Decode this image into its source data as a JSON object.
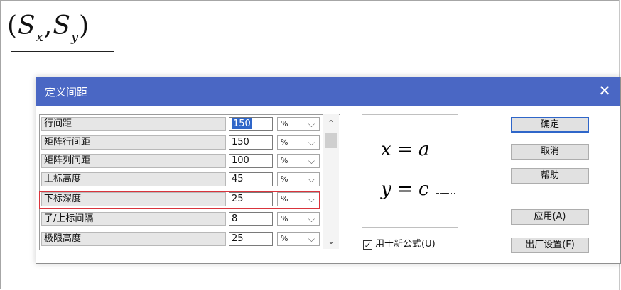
{
  "formula": {
    "open": "(",
    "s1": "S",
    "sub1": "x",
    "comma": ",",
    "s2": "S",
    "sub2": "y",
    "close": ")"
  },
  "dialog": {
    "title": "定义间距",
    "close_glyph": "✕",
    "rows": [
      {
        "name": "行间距",
        "value": "150",
        "unit": "%"
      },
      {
        "name": "矩阵行间距",
        "value": "150",
        "unit": "%"
      },
      {
        "name": "矩阵列间距",
        "value": "100",
        "unit": "%"
      },
      {
        "name": "上标高度",
        "value": "45",
        "unit": "%"
      },
      {
        "name": "下标深度",
        "value": "25",
        "unit": "%"
      },
      {
        "name": "子/上标间隔",
        "value": "8",
        "unit": "%"
      },
      {
        "name": "极限高度",
        "value": "25",
        "unit": "%"
      }
    ],
    "selected_row": "行间距",
    "highlighted_row": "下标深度",
    "dropdown_chevron": "⌵",
    "scroll_up": "⌃",
    "scroll_down": "⌄",
    "preview": {
      "line1": {
        "var": "x",
        "op": "=",
        "rhs": "a"
      },
      "line2": {
        "var": "y",
        "op": "=",
        "rhs": "c"
      }
    },
    "checkbox": {
      "label": "用于新公式(U)",
      "checked": true,
      "mark": "✓"
    },
    "buttons": {
      "ok": "确定",
      "cancel": "取消",
      "help": "帮助",
      "apply": "应用(A)",
      "factory": "出厂设置(F)"
    },
    "colors": {
      "titlebar": "#4a67c4",
      "highlight": "#d9343c",
      "selection": "#2f66c9"
    }
  }
}
